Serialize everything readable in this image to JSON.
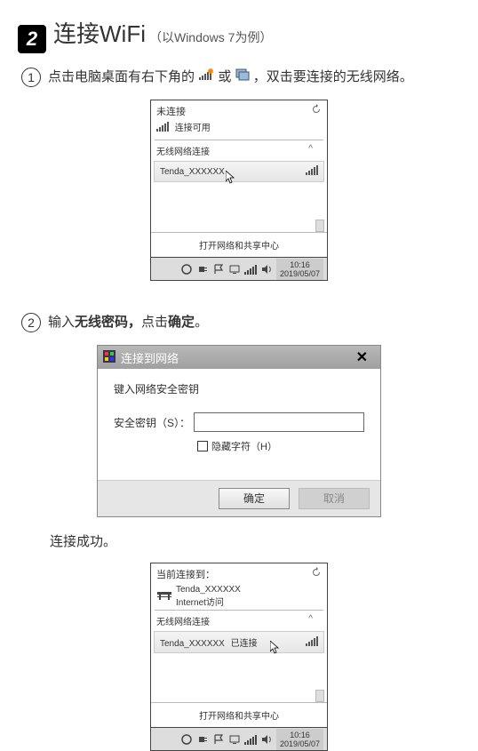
{
  "section": {
    "number": "2",
    "title": "连接WiFi",
    "subtitle": "（以Windows 7为例）"
  },
  "step1": {
    "number": "1",
    "text_before": "点击电脑桌面有右下角的",
    "text_mid": "或",
    "text_after": "，双击要连接的无线网络。"
  },
  "wifi_panel1": {
    "header": "未连接",
    "sub": "连接可用",
    "section_label": "无线网络连接",
    "item_name": "Tenda_XXXXXX",
    "footer": "打开网络和共享中心"
  },
  "taskbar": {
    "time": "10:16",
    "date": "2019/05/07"
  },
  "step2": {
    "number": "2",
    "text_1": "输入",
    "text_bold1": "无线密码，",
    "text_2": "点击",
    "text_bold2": "确定",
    "text_3": "。"
  },
  "dialog": {
    "title": "连接到网络",
    "label1": "键入网络安全密钥",
    "key_label": "安全密钥（S）：",
    "hide_label": "隐藏字符（H）",
    "ok": "确定",
    "cancel": "取消"
  },
  "success_label": "连接成功。",
  "wifi_panel2": {
    "header": "当前连接到：",
    "ssid": "Tenda_XXXXXX",
    "access": "Internet访问",
    "section_label": "无线网络连接",
    "item_name": "Tenda_XXXXXX",
    "item_status": "已连接",
    "footer": "打开网络和共享中心"
  }
}
